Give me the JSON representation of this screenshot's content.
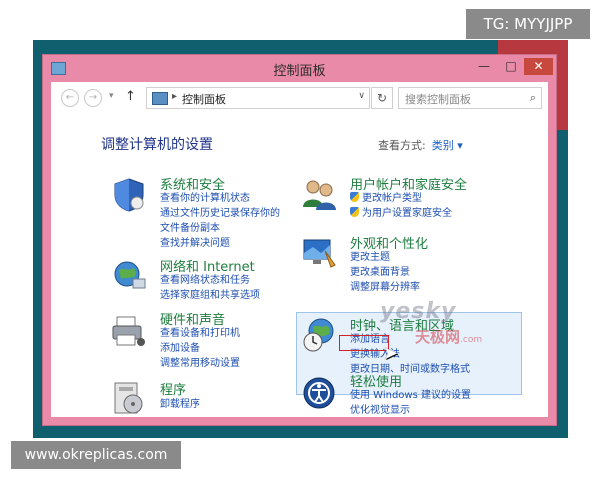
{
  "watermarks": {
    "top": "TG: MYYJJPP",
    "bottom": "www.okreplicas.com",
    "site_logo": "yesky",
    "site_logo_cn": "天极网",
    "site_logo_suffix": ".com"
  },
  "window": {
    "title": "控制面板",
    "buttons": {
      "minimize": "—",
      "maximize": "□",
      "close": "✕"
    }
  },
  "navbar": {
    "back": "←",
    "forward": "→",
    "recent": "▾",
    "up": "↑",
    "separator": "▸",
    "breadcrumb": "控制面板",
    "dropdown": "∨",
    "refresh": "↻",
    "search_placeholder": "搜索控制面板",
    "search_icon": "⌕"
  },
  "main": {
    "heading": "调整计算机的设置",
    "view_by_label": "查看方式:",
    "view_by_value": "类别 ▾"
  },
  "categories": [
    {
      "title": "系统和安全",
      "icon": "shield-icon",
      "links": [
        "查看你的计算机状态",
        "通过文件历史记录保存你的",
        "文件备份副本",
        "查找并解决问题"
      ]
    },
    {
      "title": "网络和 Internet",
      "icon": "globe-network-icon",
      "links": [
        "查看网络状态和任务",
        "选择家庭组和共享选项"
      ]
    },
    {
      "title": "硬件和声音",
      "icon": "printer-icon",
      "links": [
        "查看设备和打印机",
        "添加设备",
        "调整常用移动设置"
      ]
    },
    {
      "title": "程序",
      "icon": "programs-icon",
      "links": [
        "卸载程序"
      ]
    },
    {
      "title": "用户帐户和家庭安全",
      "icon": "users-icon",
      "links": [
        "更改帐户类型",
        "为用户设置家庭安全"
      ]
    },
    {
      "title": "外观和个性化",
      "icon": "appearance-icon",
      "links": [
        "更改主题",
        "更改桌面背景",
        "调整屏幕分辨率"
      ]
    },
    {
      "title": "时钟、语言和区域",
      "icon": "clock-globe-icon",
      "links": [
        "添加语言",
        "更换输入法",
        "更改日期、时间或数字格式"
      ]
    },
    {
      "title": "轻松使用",
      "icon": "ease-of-access-icon",
      "links": [
        "使用 Windows 建议的设置",
        "优化视觉显示"
      ]
    }
  ],
  "colors": {
    "window_frame": "#e98aa8",
    "category_title": "#1e7d3f",
    "link": "#1e4fb0",
    "heading": "#1e3287",
    "close_button": "#c7483d"
  }
}
